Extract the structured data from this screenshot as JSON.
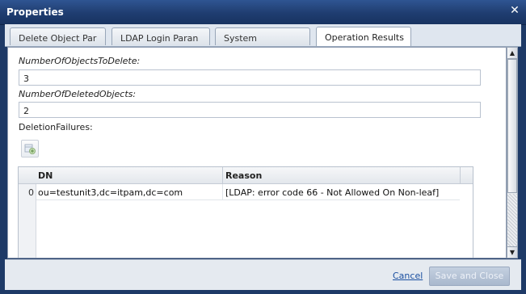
{
  "window": {
    "title": "Properties",
    "close_icon": "close-icon"
  },
  "tabs": [
    {
      "label": "Delete Object Par",
      "active": false
    },
    {
      "label": "LDAP Login Paran",
      "active": false
    },
    {
      "label": "System",
      "active": false
    },
    {
      "label": "Operation Results",
      "active": true
    }
  ],
  "fields": {
    "objects_to_delete": {
      "label": "NumberOfObjectsToDelete:",
      "value": "3"
    },
    "deleted_objects": {
      "label": "NumberOfDeletedObjects:",
      "value": "2"
    },
    "deletion_failures": {
      "label": "DeletionFailures:"
    }
  },
  "grid": {
    "columns": [
      "DN",
      "Reason"
    ],
    "rows": [
      {
        "index": "0",
        "dn": "ou=testunit3,dc=itpam,dc=com",
        "reason": "[LDAP: error code 66 - Not Allowed On Non-leaf]"
      }
    ]
  },
  "footer": {
    "cancel_label": "Cancel",
    "save_label": "Save and Close"
  },
  "colors": {
    "titlebar": "#1f3d70",
    "link": "#1a4fa0",
    "save_disabled": "#a9b8cd"
  }
}
